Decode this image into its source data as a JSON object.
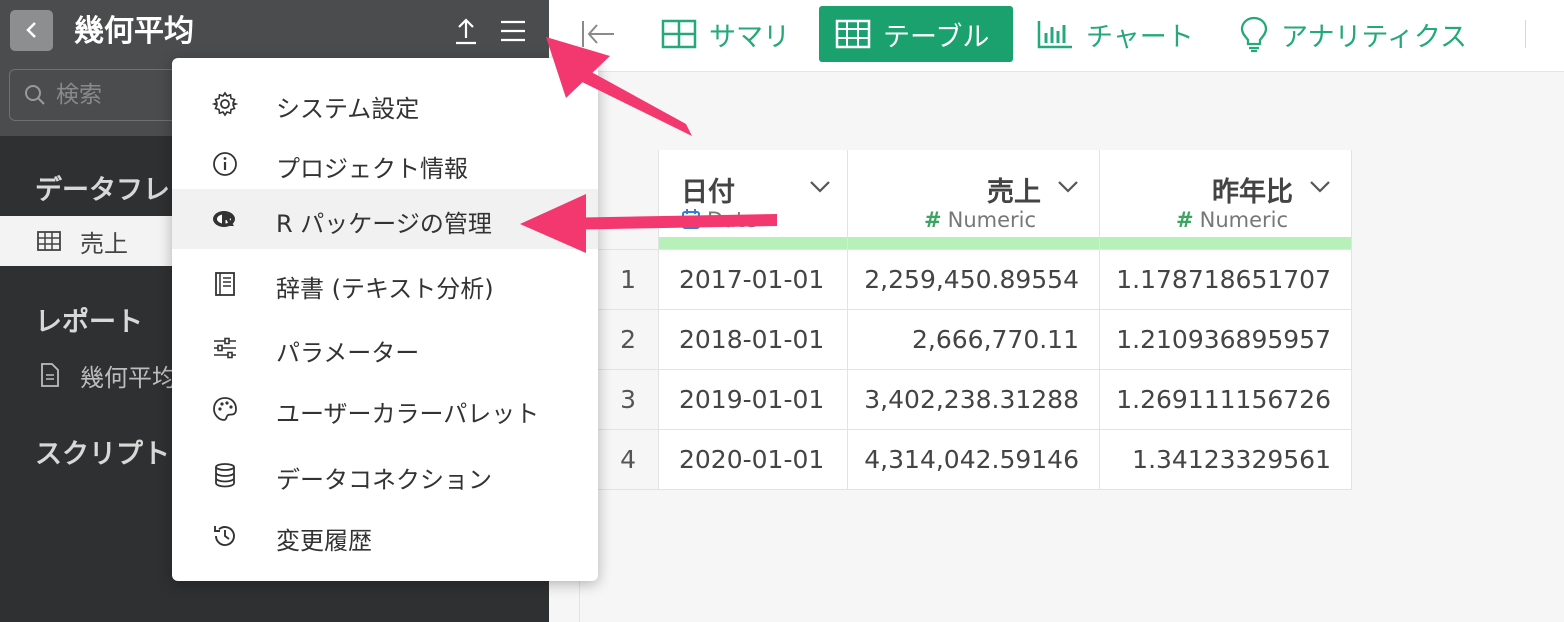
{
  "sidebar": {
    "title": "幾何平均",
    "search_placeholder": "検索",
    "sections": [
      {
        "title": "データフレーム"
      },
      {
        "title": "レポート"
      },
      {
        "title": "スクリプト"
      }
    ],
    "dataframe_item": "売上",
    "report_item": "幾何平均"
  },
  "toolbar": {
    "tabs": [
      {
        "label": "サマリ",
        "icon": "grid-icon"
      },
      {
        "label": "テーブル",
        "icon": "table-icon",
        "active": true
      },
      {
        "label": "チャート",
        "icon": "bar-chart-icon"
      },
      {
        "label": "アナリティクス",
        "icon": "lightbulb-icon"
      }
    ]
  },
  "menu": {
    "items": [
      {
        "label": "システム設定",
        "icon": "gear-icon"
      },
      {
        "label": "プロジェクト情報",
        "icon": "info-icon"
      },
      {
        "label": "R パッケージの管理",
        "icon": "r-logo-icon",
        "highlighted": true
      },
      {
        "label": "辞書 (テキスト分析)",
        "icon": "book-icon"
      },
      {
        "label": "パラメーター",
        "icon": "sliders-icon"
      },
      {
        "label": "ユーザーカラーパレット",
        "icon": "palette-icon"
      },
      {
        "label": "データコネクション",
        "icon": "database-icon"
      },
      {
        "label": "変更履歴",
        "icon": "history-icon"
      }
    ]
  },
  "table": {
    "columns": [
      {
        "name": "日付",
        "type": "Date"
      },
      {
        "name": "売上",
        "type": "Numeric"
      },
      {
        "name": "昨年比",
        "type": "Numeric"
      }
    ],
    "rows": [
      {
        "n": "1",
        "date": "2017-01-01",
        "sales": "2,259,450.89554",
        "yoy": "1.178718651707"
      },
      {
        "n": "2",
        "date": "2018-01-01",
        "sales": "2,666,770.11",
        "yoy": "1.210936895957"
      },
      {
        "n": "3",
        "date": "2019-01-01",
        "sales": "3,402,238.31288",
        "yoy": "1.269111156726"
      },
      {
        "n": "4",
        "date": "2020-01-01",
        "sales": "4,314,042.59146",
        "yoy": "1.34123329561"
      }
    ]
  },
  "colors": {
    "accent": "#1aa16e",
    "annotation_arrow": "#f2386f"
  }
}
